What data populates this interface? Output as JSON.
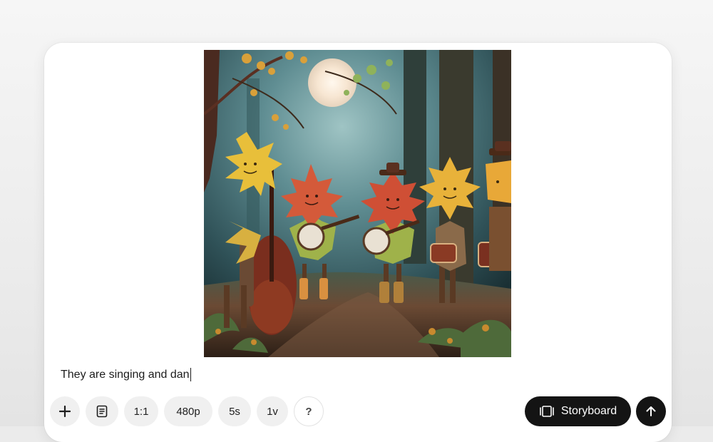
{
  "composer": {
    "prompt_text": "They are singing and dan",
    "preview_image": {
      "icon": "generated-image-autumn-leaf-band",
      "colors": {
        "forest_dark": "#1f3a40",
        "forest_light": "#5f8d92",
        "moon": "#fbefe0",
        "leaf_yellow": "#e8bf3a",
        "leaf_red": "#d45a3a",
        "path": "#6b4a34"
      }
    }
  },
  "toolbar": {
    "add_icon": "plus-icon",
    "presets_icon": "document-list-icon",
    "aspect_ratio": "1:1",
    "resolution": "480p",
    "duration": "5s",
    "variations": "1v",
    "help_label": "?",
    "storyboard_label": "Storyboard",
    "storyboard_icon": "film-frames-icon",
    "submit_icon": "arrow-up-icon"
  },
  "colors": {
    "background": "#ebebeb",
    "card": "#ffffff",
    "pill": "#f0f0f0",
    "primary_button": "#141414"
  }
}
